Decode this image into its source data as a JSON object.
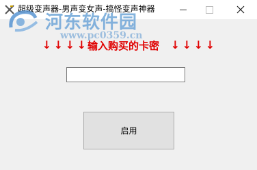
{
  "window": {
    "title": "超级变声器-男声变女声-搞怪变声神器",
    "controls": {
      "minimize": "—",
      "maximize": "☐",
      "close": "✕"
    }
  },
  "watermark": {
    "text": "河东软件园",
    "url": "www.pc0359.cn",
    "color": "#6fa6d8"
  },
  "prompt": {
    "text": "输入购买的卡密",
    "arrow": "↓",
    "color": "#e00000"
  },
  "card_input": {
    "value": "",
    "placeholder": ""
  },
  "enable_button": {
    "label": "启用"
  }
}
